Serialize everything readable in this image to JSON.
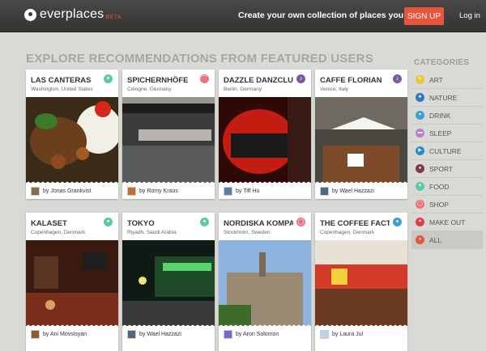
{
  "header": {
    "logo_text": "everplaces",
    "beta": "BETA",
    "tagline": "Create your own collection of places you love",
    "signup_label": "SIGN UP",
    "login_label": "Log in"
  },
  "main": {
    "heading": "EXPLORE RECOMMENDATIONS FROM FEATURED USERS"
  },
  "cards": [
    {
      "title": "LAS CANTERAS",
      "location": "Washington, United States",
      "user": "by Jonas Grankvist",
      "icon": "food-icon",
      "color": "#5fc7a6"
    },
    {
      "title": "SPICHERNHÖFE",
      "location": "Cologne, Germany",
      "user": "by Romy Kraus",
      "icon": "sleep-icon",
      "color": "#e8757a"
    },
    {
      "title": "DAZZLE DANZCLUB",
      "location": "Berlin, Germany",
      "user": "by Tiff Hu",
      "icon": "music-icon",
      "color": "#7b5aa3"
    },
    {
      "title": "CAFFE FLORIAN",
      "location": "Venice, Italy",
      "user": "by Wael Hazzazi",
      "icon": "music-icon",
      "color": "#7b5aa3"
    },
    {
      "title": "KALASET",
      "location": "Copenhagen, Denmark",
      "user": "by Ani Movsisyan",
      "icon": "food-icon",
      "color": "#5fc7a6"
    },
    {
      "title": "TOKYO",
      "location": "Riyadh, Saudi Arabia",
      "user": "by Wael Hazzazi",
      "icon": "food-icon",
      "color": "#5fc7a6"
    },
    {
      "title": "NORDISKA KOMPANIET (NK)",
      "location": "Stockholm, Sweden",
      "user": "by Aron Solomon",
      "icon": "shop-icon",
      "color": "#f0707a"
    },
    {
      "title": "THE COFFEE FACTORY",
      "location": "Copenhagen, Denmark",
      "user": "by Laura Jul",
      "icon": "drink-icon",
      "color": "#3d9fd6"
    }
  ],
  "categories": {
    "title": "CATEGORIES",
    "items": [
      {
        "label": "ART",
        "color": "#e8c63a",
        "icon": "art-icon"
      },
      {
        "label": "NATURE",
        "color": "#2f75c4",
        "icon": "nature-icon"
      },
      {
        "label": "DRINK",
        "color": "#3d9fd6",
        "icon": "drink-icon"
      },
      {
        "label": "SLEEP",
        "color": "#c07ccb",
        "icon": "sleep-icon"
      },
      {
        "label": "CULTURE",
        "color": "#2a8ad0",
        "icon": "culture-icon"
      },
      {
        "label": "SPORT",
        "color": "#7b3a4e",
        "icon": "sport-icon"
      },
      {
        "label": "FOOD",
        "color": "#5fc7a6",
        "icon": "food-icon"
      },
      {
        "label": "SHOP",
        "color": "#f0707a",
        "icon": "shop-icon"
      },
      {
        "label": "MAKE OUT",
        "color": "#e8394a",
        "icon": "heart-icon"
      },
      {
        "label": "ALL",
        "color": "#e8553b",
        "icon": "all-icon"
      }
    ]
  }
}
